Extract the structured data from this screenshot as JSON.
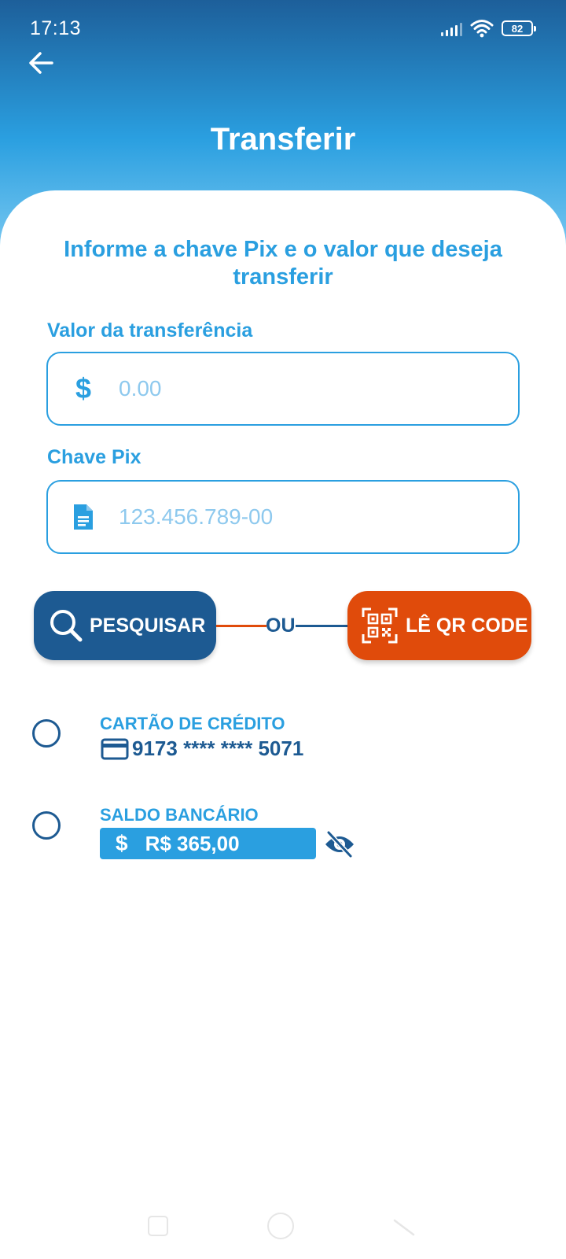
{
  "status_bar": {
    "time": "17:13",
    "battery": "82",
    "icons": [
      "signal-icon",
      "wifi-icon",
      "battery-icon"
    ]
  },
  "header": {
    "back_icon": "arrow-left-icon",
    "title": "Transferir"
  },
  "form": {
    "subtitle": "Informe a chave Pix e o valor que deseja transferir",
    "amount": {
      "label": "Valor da transferência",
      "icon": "dollar-icon",
      "placeholder": "0.00",
      "value": ""
    },
    "pix_key": {
      "label": "Chave Pix",
      "icon": "document-icon",
      "placeholder": "123.456.789-00",
      "value": ""
    }
  },
  "actions": {
    "search_label": "PESQUISAR",
    "or_label": "OU",
    "qr_label": "LÊ QR CODE"
  },
  "payment_options": [
    {
      "title": "CARTÃO DE CRÉDITO",
      "icon": "credit-card-icon",
      "detail": "9173 **** **** 5071",
      "selected": false
    },
    {
      "title": "SALDO BANCÁRIO",
      "currency_symbol": "$",
      "detail": "R$ 365,00",
      "visibility_icon": "eye-off-icon",
      "selected": false
    }
  ],
  "colors": {
    "primary_blue": "#2a9fe0",
    "dark_blue": "#1d5a92",
    "orange": "#e04b0b",
    "white": "#ffffff"
  },
  "nav_bar": {
    "icons": [
      "recent-apps-icon",
      "home-icon",
      "back-nav-icon"
    ]
  }
}
